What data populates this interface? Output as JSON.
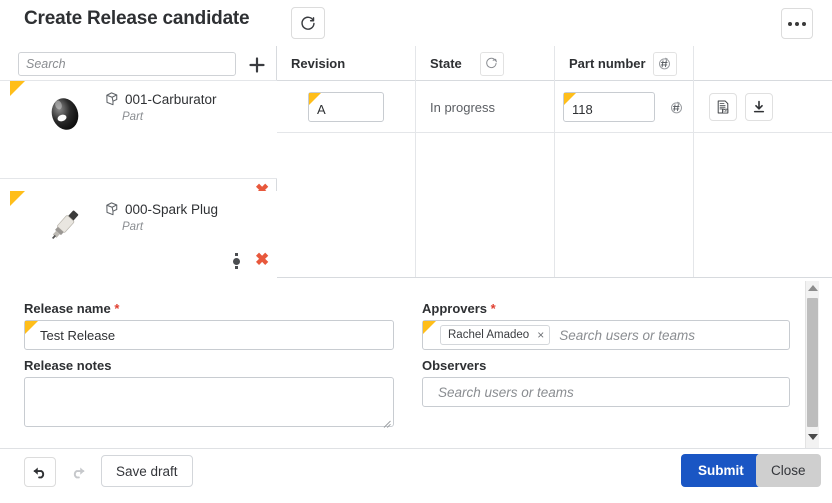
{
  "header": {
    "title": "Create Release candidate",
    "refresh_icon": "refresh-circle-icon",
    "overflow_icon": "more-horizontal-icon"
  },
  "left_panel": {
    "search": {
      "placeholder": "Search",
      "value": ""
    },
    "add_icon": "plus-icon",
    "items": [
      {
        "name": "001-Carburator",
        "type": "Part",
        "type_icon": "part-icon",
        "thumbnail": "carburator-thumbnail",
        "delete_icon": "delete-x-icon",
        "has_overflow": false,
        "modified_flag": true
      },
      {
        "name": "000-Spark Plug",
        "type": "Part",
        "type_icon": "part-icon",
        "thumbnail": "spark-plug-thumbnail",
        "delete_icon": "delete-x-icon",
        "has_overflow": true,
        "overflow_icon": "more-vertical-icon",
        "modified_flag": true
      }
    ]
  },
  "table": {
    "columns": [
      {
        "label": "Revision",
        "icon": null
      },
      {
        "label": "State",
        "icon": "rotate-up-icon"
      },
      {
        "label": "Part number",
        "icon": "hash-circle-icon"
      },
      {
        "label": "",
        "icon": null
      }
    ],
    "rows": [
      {
        "revision": "A",
        "state": "In progress",
        "part_number": "118",
        "part_number_icon": "hash-circle-icon",
        "actions": [
          {
            "icon": "document-report-icon"
          },
          {
            "icon": "download-icon"
          }
        ]
      }
    ]
  },
  "form": {
    "release_name": {
      "label": "Release name",
      "required": true,
      "value": "Test Release",
      "modified_flag": true
    },
    "release_notes": {
      "label": "Release notes",
      "required": false,
      "value": ""
    },
    "approvers": {
      "label": "Approvers",
      "required": true,
      "chips": [
        {
          "name": "Rachel Amadeo",
          "remove_icon": "chip-close-icon"
        }
      ],
      "placeholder": "Search users or teams",
      "modified_flag": true
    },
    "observers": {
      "label": "Observers",
      "required": false,
      "chips": [],
      "placeholder": "Search users or teams"
    }
  },
  "scrollbar": {
    "up_icon": "scroll-up-arrow-icon",
    "down_icon": "scroll-down-arrow-icon"
  },
  "footer": {
    "undo_icon": "undo-arrow-icon",
    "redo_icon": "redo-arrow-icon",
    "save_draft_label": "Save draft",
    "submit_label": "Submit",
    "close_label": "Close"
  },
  "colors": {
    "accent_blue": "#1a56c4",
    "flag_yellow": "#ffbe1a",
    "delete_red": "#e8583c",
    "required_red": "#e03e2f",
    "close_gray": "#cfcfcf"
  }
}
